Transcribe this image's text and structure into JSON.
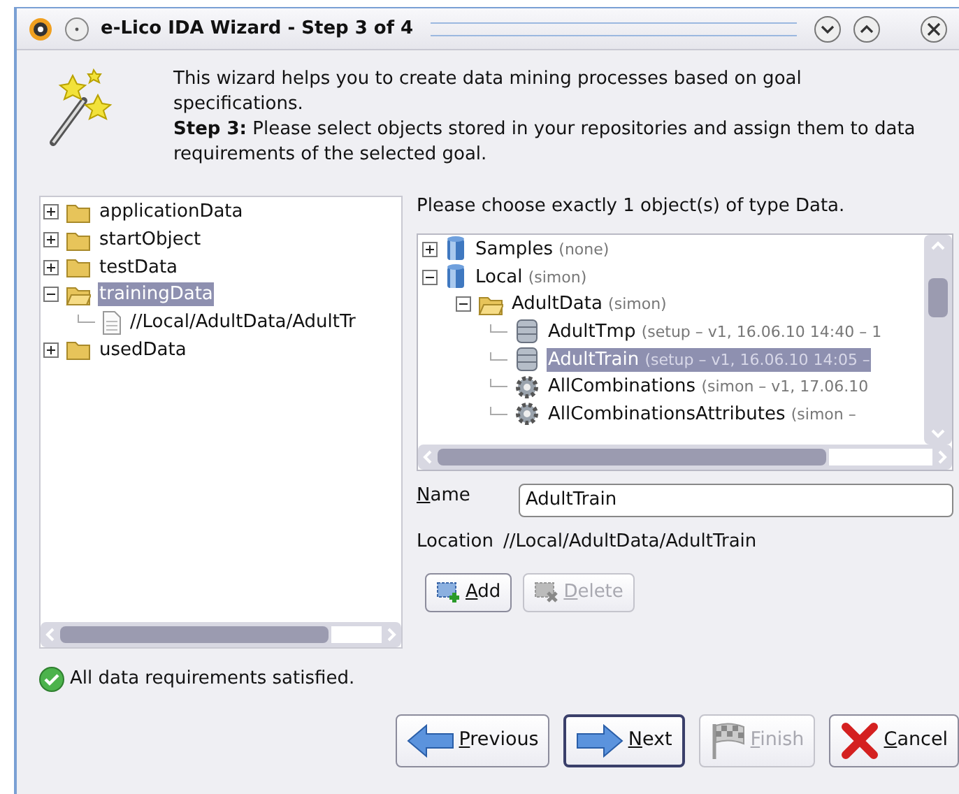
{
  "window": {
    "title": "e-Lico IDA Wizard - Step 3 of 4"
  },
  "intro": {
    "text": "This wizard helps you to create data mining processes based on goal specifications.",
    "step": "**Step 3:** Please select objects stored in your repositories and assign them to data requirements of the selected goal."
  },
  "requirements_tree": [
    {
      "label": "applicationData",
      "kind": "folder",
      "expanded": false,
      "selected": false
    },
    {
      "label": "startObject",
      "kind": "folder",
      "expanded": false,
      "selected": false
    },
    {
      "label": "testData",
      "kind": "folder",
      "expanded": false,
      "selected": false
    },
    {
      "label": "trainingData",
      "kind": "folder",
      "expanded": true,
      "selected": true,
      "children": [
        {
          "label": "//Local/AdultData/AdultTr",
          "kind": "file",
          "selected": false
        }
      ]
    },
    {
      "label": "usedData",
      "kind": "folder",
      "expanded": false,
      "selected": false
    }
  ],
  "prompt": "Please choose exactly 1 object(s) of type Data.",
  "repository_tree": [
    {
      "label": "Samples",
      "detail": "(none)",
      "kind": "repository",
      "expanded": false,
      "selected": false
    },
    {
      "label": "Local",
      "detail": "(simon)",
      "kind": "repository",
      "expanded": true,
      "selected": false,
      "children": [
        {
          "label": "AdultData",
          "detail": "(simon)",
          "kind": "folder",
          "expanded": true,
          "selected": false,
          "children": [
            {
              "label": "AdultTmp",
              "detail": "(setup – v1, 16.06.10 14:40 – 1",
              "kind": "data",
              "selected": false
            },
            {
              "label": "AdultTrain",
              "detail": "(setup – v1, 16.06.10 14:05 –",
              "kind": "data",
              "selected": true
            },
            {
              "label": "AllCombinations",
              "detail": "(simon – v1, 17.06.10",
              "kind": "process",
              "selected": false
            },
            {
              "label": "AllCombinationsAttributes",
              "detail": "(simon –",
              "kind": "process",
              "selected": false
            }
          ]
        }
      ]
    }
  ],
  "name_field": {
    "label": "Name",
    "value": "AdultTrain"
  },
  "location": {
    "label": "Location",
    "value": "//Local/AdultData/AdultTrain"
  },
  "object_buttons": [
    {
      "label": "Add",
      "kind": "add",
      "disabled": false
    },
    {
      "label": "Delete",
      "kind": "delete",
      "disabled": true
    }
  ],
  "status": "All data requirements satisfied.",
  "buttons": [
    {
      "label": "Previous",
      "kind": "previous",
      "disabled": false,
      "default": false
    },
    {
      "label": "Next",
      "kind": "next",
      "disabled": false,
      "default": true
    },
    {
      "label": "Finish",
      "kind": "finish",
      "disabled": true,
      "default": false
    },
    {
      "label": "Cancel",
      "kind": "cancel",
      "disabled": false,
      "default": false
    }
  ]
}
